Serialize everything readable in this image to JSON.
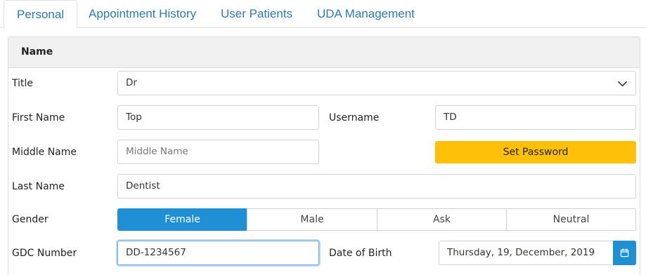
{
  "tabs": [
    {
      "label": "Personal",
      "active": true
    },
    {
      "label": "Appointment History",
      "active": false
    },
    {
      "label": "User Patients",
      "active": false
    },
    {
      "label": "UDA Management",
      "active": false
    }
  ],
  "section": {
    "header": "Name"
  },
  "fields": {
    "title": {
      "label": "Title",
      "value": "Dr"
    },
    "first_name": {
      "label": "First Name",
      "value": "Top"
    },
    "username": {
      "label": "Username",
      "value": "TD"
    },
    "middle_name": {
      "label": "Middle Name",
      "placeholder": "Middle Name"
    },
    "set_password": {
      "label": "Set Password"
    },
    "last_name": {
      "label": "Last Name",
      "value": "Dentist"
    },
    "gender": {
      "label": "Gender",
      "options": [
        "Female",
        "Male",
        "Ask",
        "Neutral"
      ],
      "selected": "Female"
    },
    "gdc_number": {
      "label": "GDC Number",
      "value": "DD-1234567"
    },
    "dob": {
      "label": "Date of Birth",
      "value": "Thursday, 19, December, 2019"
    }
  },
  "colors": {
    "accent": "#1f90d3",
    "warning": "#ffc107",
    "link": "#2a7ab8"
  },
  "icons": {
    "select": "chevron-down-icon",
    "calendar": "calendar-icon"
  }
}
